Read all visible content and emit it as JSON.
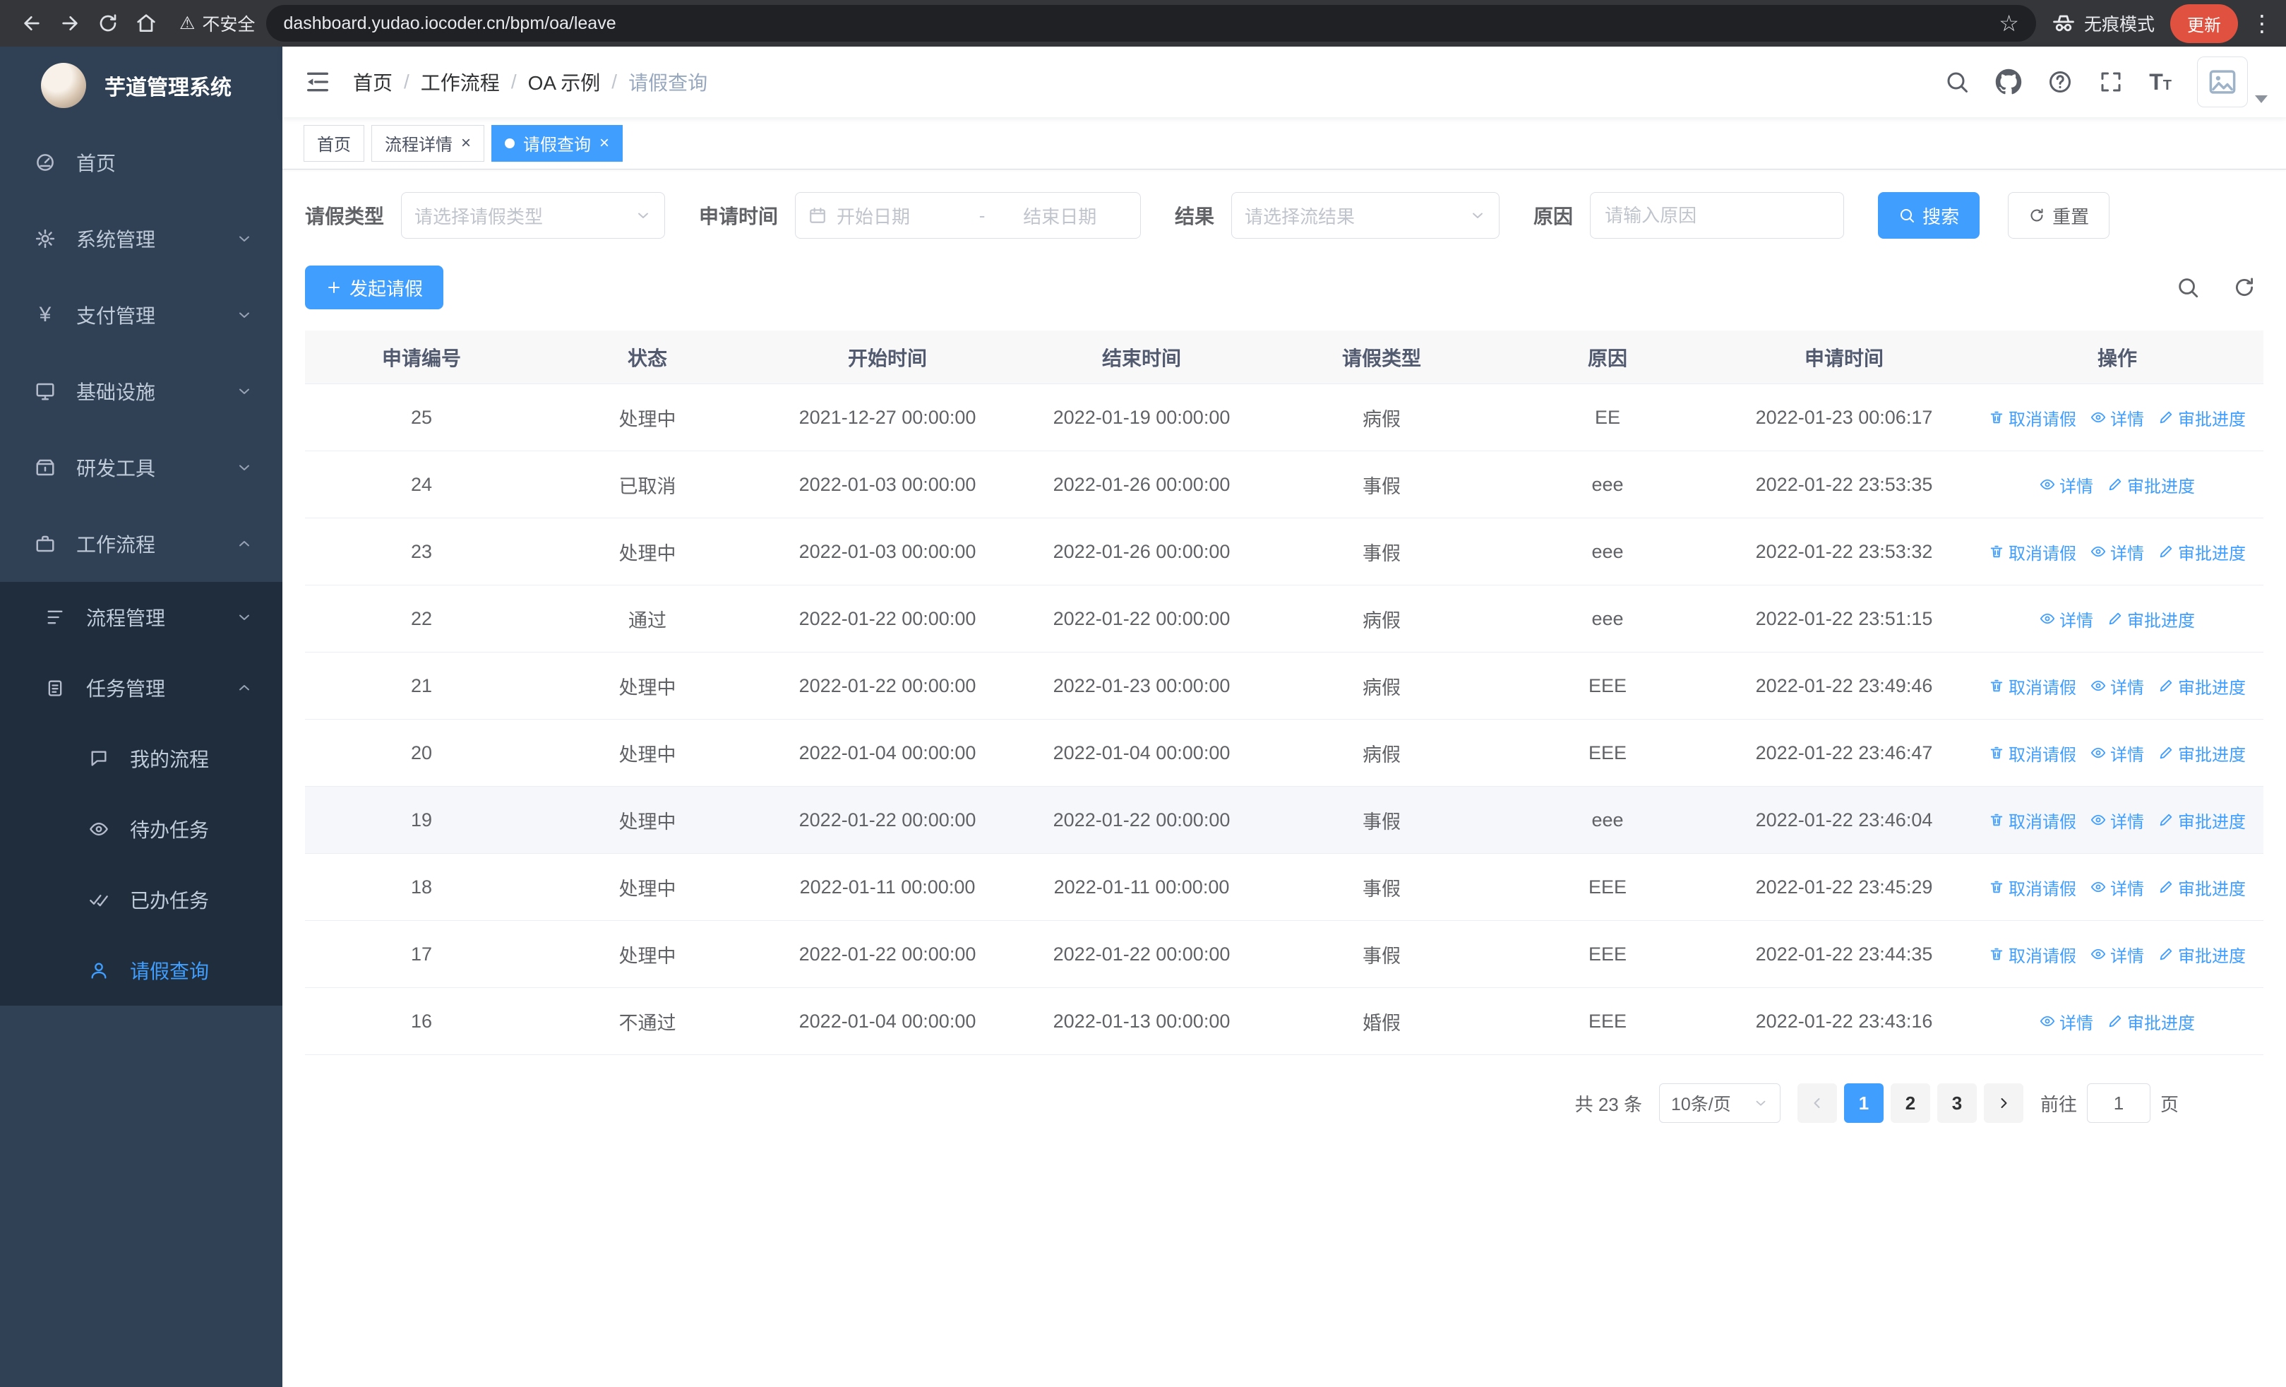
{
  "browser": {
    "security_warning": "不安全",
    "url": "dashboard.yudao.iocoder.cn/bpm/oa/leave",
    "incognito_label": "无痕模式",
    "update_label": "更新"
  },
  "icons": {
    "warning_glyph": "⚠",
    "star_glyph": "☆",
    "kebab_glyph": "⋮",
    "yen_glyph": "¥",
    "font_big": "T",
    "font_small": "T"
  },
  "sidebar": {
    "logo_title": "芋道管理系统",
    "menu": [
      {
        "label": "首页"
      },
      {
        "label": "系统管理"
      },
      {
        "label": "支付管理"
      },
      {
        "label": "基础设施"
      },
      {
        "label": "研发工具"
      },
      {
        "label": "工作流程"
      }
    ],
    "submenu": [
      {
        "label": "流程管理"
      },
      {
        "label": "任务管理"
      }
    ],
    "task_children": [
      {
        "label": "我的流程"
      },
      {
        "label": "待办任务"
      },
      {
        "label": "已办任务"
      },
      {
        "label": "请假查询"
      }
    ]
  },
  "header": {
    "breadcrumb": [
      "首页",
      "工作流程",
      "OA 示例",
      "请假查询"
    ],
    "separator": "/"
  },
  "tabs": {
    "items": [
      {
        "label": "首页"
      },
      {
        "label": "流程详情"
      },
      {
        "label": "请假查询"
      }
    ],
    "close_glyph": "×"
  },
  "filters": {
    "leave_type_label": "请假类型",
    "leave_type_placeholder": "请选择请假类型",
    "apply_time_label": "申请时间",
    "start_date_placeholder": "开始日期",
    "range_separator": "-",
    "end_date_placeholder": "结束日期",
    "result_label": "结果",
    "result_placeholder": "请选择流结果",
    "reason_label": "原因",
    "reason_placeholder": "请输入原因",
    "search_label": "搜索",
    "reset_label": "重置"
  },
  "toolbar": {
    "create_label": "发起请假"
  },
  "table": {
    "columns": [
      "申请编号",
      "状态",
      "开始时间",
      "结束时间",
      "请假类型",
      "原因",
      "申请时间",
      "操作"
    ],
    "action_labels": {
      "cancel": "取消请假",
      "detail": "详情",
      "progress": "审批进度"
    },
    "rows": [
      {
        "id": "25",
        "status": "处理中",
        "start_time": "2021-12-27 00:00:00",
        "end_time": "2022-01-19 00:00:00",
        "leave_type": "病假",
        "reason": "EE",
        "apply_time": "2022-01-23 00:06:17",
        "actions": [
          "cancel",
          "detail",
          "progress"
        ],
        "highlighted": false
      },
      {
        "id": "24",
        "status": "已取消",
        "start_time": "2022-01-03 00:00:00",
        "end_time": "2022-01-26 00:00:00",
        "leave_type": "事假",
        "reason": "eee",
        "apply_time": "2022-01-22 23:53:35",
        "actions": [
          "detail",
          "progress"
        ],
        "highlighted": false
      },
      {
        "id": "23",
        "status": "处理中",
        "start_time": "2022-01-03 00:00:00",
        "end_time": "2022-01-26 00:00:00",
        "leave_type": "事假",
        "reason": "eee",
        "apply_time": "2022-01-22 23:53:32",
        "actions": [
          "cancel",
          "detail",
          "progress"
        ],
        "highlighted": false
      },
      {
        "id": "22",
        "status": "通过",
        "start_time": "2022-01-22 00:00:00",
        "end_time": "2022-01-22 00:00:00",
        "leave_type": "病假",
        "reason": "eee",
        "apply_time": "2022-01-22 23:51:15",
        "actions": [
          "detail",
          "progress"
        ],
        "highlighted": false
      },
      {
        "id": "21",
        "status": "处理中",
        "start_time": "2022-01-22 00:00:00",
        "end_time": "2022-01-23 00:00:00",
        "leave_type": "病假",
        "reason": "EEE",
        "apply_time": "2022-01-22 23:49:46",
        "actions": [
          "cancel",
          "detail",
          "progress"
        ],
        "highlighted": false
      },
      {
        "id": "20",
        "status": "处理中",
        "start_time": "2022-01-04 00:00:00",
        "end_time": "2022-01-04 00:00:00",
        "leave_type": "病假",
        "reason": "EEE",
        "apply_time": "2022-01-22 23:46:47",
        "actions": [
          "cancel",
          "detail",
          "progress"
        ],
        "highlighted": false
      },
      {
        "id": "19",
        "status": "处理中",
        "start_time": "2022-01-22 00:00:00",
        "end_time": "2022-01-22 00:00:00",
        "leave_type": "事假",
        "reason": "eee",
        "apply_time": "2022-01-22 23:46:04",
        "actions": [
          "cancel",
          "detail",
          "progress"
        ],
        "highlighted": true
      },
      {
        "id": "18",
        "status": "处理中",
        "start_time": "2022-01-11 00:00:00",
        "end_time": "2022-01-11 00:00:00",
        "leave_type": "事假",
        "reason": "EEE",
        "apply_time": "2022-01-22 23:45:29",
        "actions": [
          "cancel",
          "detail",
          "progress"
        ],
        "highlighted": false
      },
      {
        "id": "17",
        "status": "处理中",
        "start_time": "2022-01-22 00:00:00",
        "end_time": "2022-01-22 00:00:00",
        "leave_type": "事假",
        "reason": "EEE",
        "apply_time": "2022-01-22 23:44:35",
        "actions": [
          "cancel",
          "detail",
          "progress"
        ],
        "highlighted": false
      },
      {
        "id": "16",
        "status": "不通过",
        "start_time": "2022-01-04 00:00:00",
        "end_time": "2022-01-13 00:00:00",
        "leave_type": "婚假",
        "reason": "EEE",
        "apply_time": "2022-01-22 23:43:16",
        "actions": [
          "detail",
          "progress"
        ],
        "highlighted": false
      }
    ]
  },
  "pagination": {
    "total_label": "共 23 条",
    "page_size": "10条/页",
    "pages": [
      "1",
      "2",
      "3"
    ],
    "goto_label": "前往",
    "goto_value": "1",
    "page_unit": "页"
  }
}
